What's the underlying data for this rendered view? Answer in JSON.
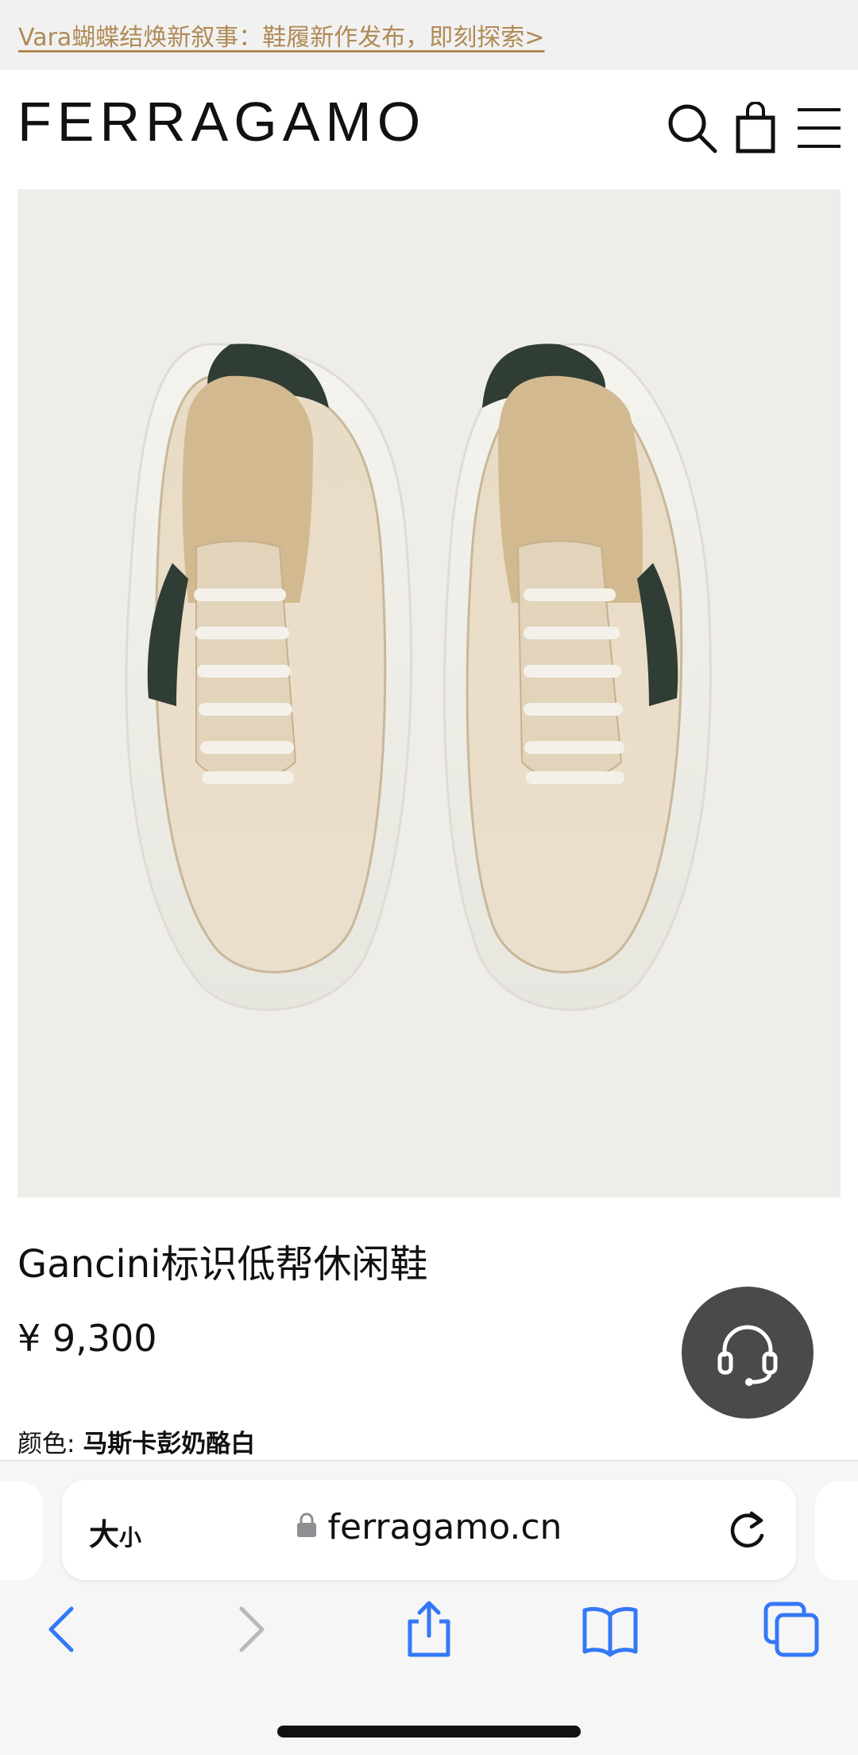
{
  "promo": {
    "text": "Vara蝴蝶结焕新叙事：鞋履新作发布，即刻探索>"
  },
  "header": {
    "logo": "FERRAGAMO",
    "icons": [
      "search-icon",
      "shopping-bag-icon",
      "menu-icon"
    ]
  },
  "gallery": {
    "image": "shoe-pair-top-view",
    "slide_count": 6,
    "active_slide": 2
  },
  "product": {
    "title": "Gancini标识低帮休闲鞋",
    "price": "¥ 9,300",
    "color_label": "颜色:",
    "color_value": "马斯卡彭奶酪白"
  },
  "support": {
    "icon": "headset-icon"
  },
  "browser": {
    "text_size_label": "大",
    "text_size_small": "小",
    "domain": "ferragamo.cn",
    "toolbar_icons": [
      "back-icon",
      "forward-icon",
      "share-icon",
      "bookmarks-icon",
      "tabs-icon"
    ]
  },
  "colors": {
    "promo_link": "#b08a55",
    "accent_blue": "#3478f6",
    "image_bg": "#efedea",
    "shoe": "#ece0cc",
    "shoe_accent": "#2f3d34"
  }
}
